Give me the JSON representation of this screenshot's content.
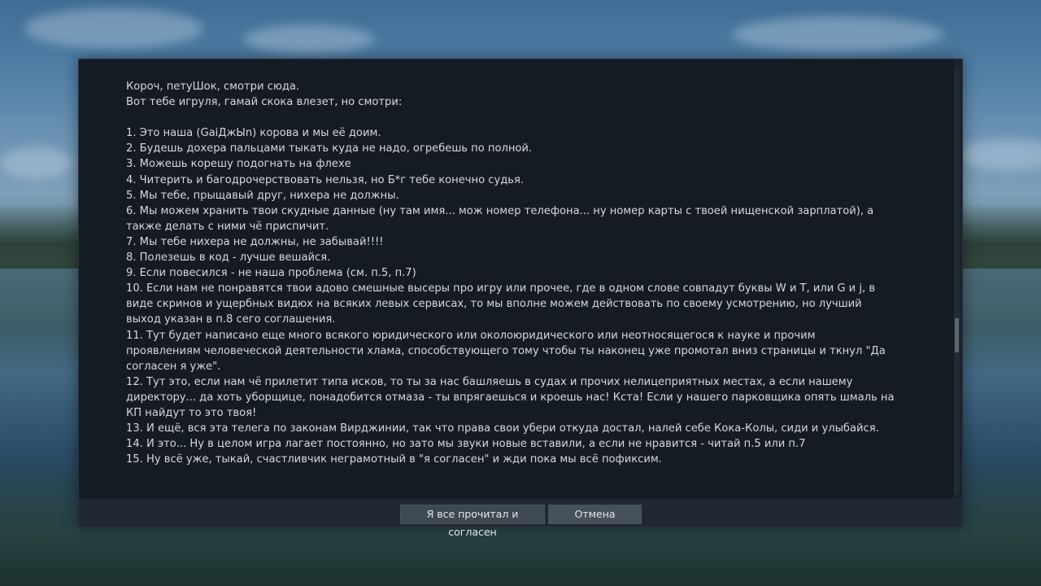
{
  "dialog": {
    "lines": [
      "Короч, петуШок, смотри сюда.",
      "Вот тебе игруля, гамай скока влезет, но смотри:",
      "",
      "1. Это наша (GaiДжЫn) корова и мы её доим.",
      "2. Будешь дохера пальцами тыкать куда не надо, огребешь по полной.",
      "3. Можешь корешу подогнать на флехе",
      "4. Читерить и багодрочерствовать нельзя, но Б*г тебе конечно судья.",
      "5. Мы тебе, прыщавый друг, нихера не должны.",
      "6. Мы можем хранить твои скудные данные (ну там имя... мож номер телефона... ну номер карты с твоей нищенской зарплатой), а",
      "также делать с ними чё приспичит.",
      "7. Мы тебе нихера не должны, не забывай!!!!",
      "8. Полезешь в код - лучше вешайся.",
      "9. Если повесился - не наша проблема (см. п.5, п.7)",
      "10. Если нам не понравятся твои адово смешные высеры про игру или прочее, где в одном слове совпадут буквы W и T, или G и j, в",
      "виде скринов и ущербных видюх на всяких левых сервисах, то мы вполне можем действовать по своему усмотрению, но лучший",
      "выход указан в п.8 сего соглашения.",
      "11. Тут будет написано еще много всякого юридического или околоюридического или неотносящегося к науке и прочим",
      "проявлениям человеческой деятельности хлама, способствующего тому чтобы ты наконец уже промотал вниз страницы и ткнул \"Да",
      "согласен я уже\".",
      "12. Тут это, если нам чё прилетит типа исков, то ты за нас башляешь в судах и прочих нелицеприятных местах, а если нашему",
      "директору... да хоть уборщице, понадобится отмаза - ты впрягаешься и кроешь нас! Кста! Если у нашего парковщика опять шмаль на",
      "КП найдут то это твоя!",
      "13. И ещё, вся эта телега по законам Вирджинии, так что права свои убери откуда достал, налей себе Кока-Колы, сиди и улыбайся.",
      "14. И это... Ну в целом игра лагает постоянно, но зато мы звуки новые вставили, а если не нравится - читай п.5 или п.7",
      "15. Ну всё уже, тыкай, счастливчик неграмотный в \"я согласен\" и жди пока мы всё пофиксим."
    ],
    "scroll_position": 0.61
  },
  "buttons": {
    "accept_label": "Я все прочитал и согласен",
    "cancel_label": "Отмена"
  },
  "colors": {
    "dialog_bg": "#151b23",
    "text": "#d4d9de",
    "button_bg": "#3e4952"
  }
}
